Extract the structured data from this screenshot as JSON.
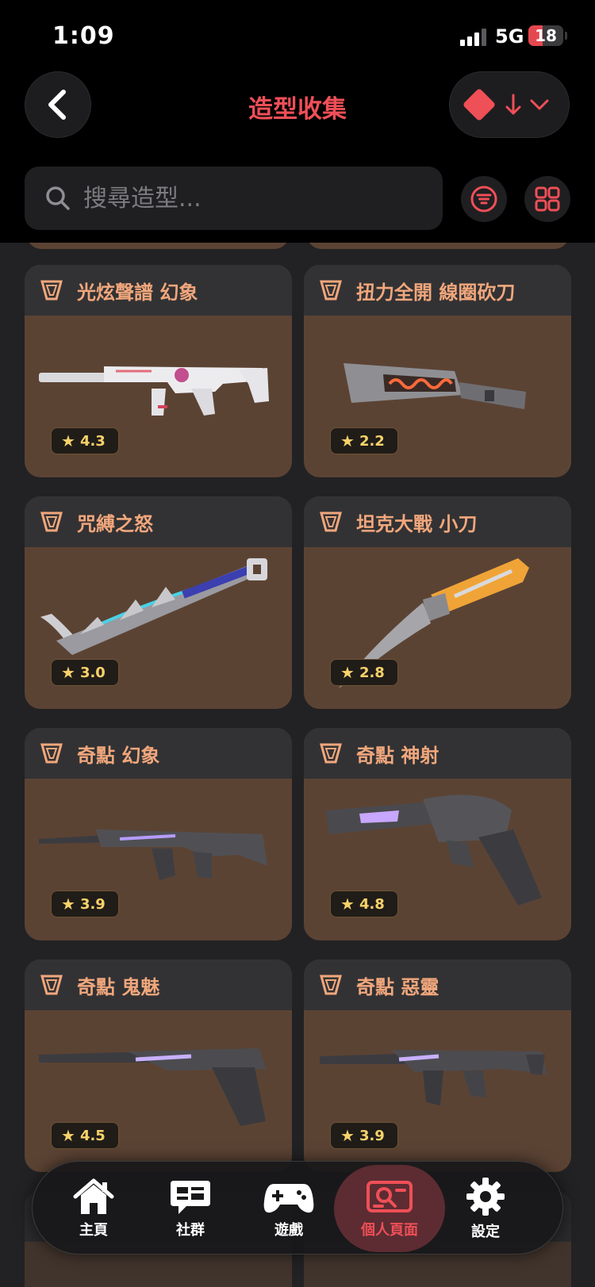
{
  "status_bar": {
    "time": "1:09",
    "network": "5G",
    "battery": "18"
  },
  "header": {
    "title": "造型收集"
  },
  "search": {
    "placeholder": "搜尋造型..."
  },
  "colors": {
    "accent": "#ef4f57",
    "card_bg": "#5b4334",
    "card_header": "#323234",
    "title_text": "#f1a77c",
    "star": "#f7d26a"
  },
  "cards": [
    {
      "title": "光炫聲譜 幻象",
      "rating": "4.3"
    },
    {
      "title": "扭力全開 線圈砍刀",
      "rating": "2.2"
    },
    {
      "title": "咒縛之怒",
      "rating": "3.0"
    },
    {
      "title": "坦克大戰 小刀",
      "rating": "2.8"
    },
    {
      "title": "奇點 幻象",
      "rating": "3.9"
    },
    {
      "title": "奇點 神射",
      "rating": "4.8"
    },
    {
      "title": "奇點 鬼魅",
      "rating": "4.5"
    },
    {
      "title": "奇點 惡靈",
      "rating": "3.9"
    }
  ],
  "tabs": [
    {
      "label": "主頁",
      "icon": "home-icon"
    },
    {
      "label": "社群",
      "icon": "chat-icon"
    },
    {
      "label": "遊戲",
      "icon": "gamepad-icon"
    },
    {
      "label": "個人頁面",
      "icon": "profile-card-icon",
      "active": true
    },
    {
      "label": "設定",
      "icon": "gear-icon"
    }
  ]
}
